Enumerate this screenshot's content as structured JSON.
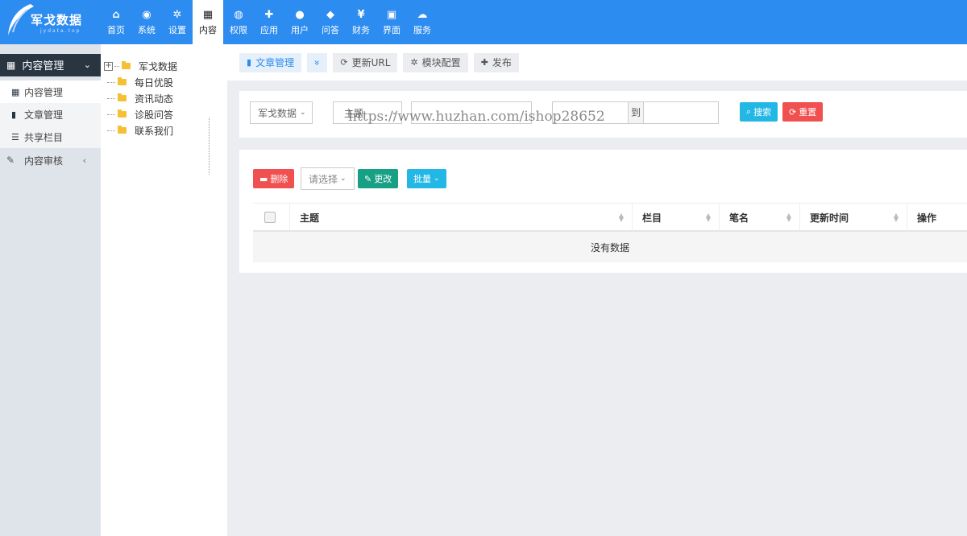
{
  "app": {
    "logo_text": "军戈数据",
    "logo_sub": "jydata.top"
  },
  "topnav": [
    {
      "label": "首页",
      "icon": "home-icon",
      "glyph": "⌂"
    },
    {
      "label": "系统",
      "icon": "globe-icon",
      "glyph": "◉"
    },
    {
      "label": "设置",
      "icon": "gears-icon",
      "glyph": "✲"
    },
    {
      "label": "内容",
      "icon": "grid-icon",
      "glyph": "▦",
      "active": true
    },
    {
      "label": "权限",
      "icon": "user-circle-icon",
      "glyph": "◍"
    },
    {
      "label": "应用",
      "icon": "puzzle-icon",
      "glyph": "✚"
    },
    {
      "label": "用户",
      "icon": "user-icon",
      "glyph": "●"
    },
    {
      "label": "问答",
      "icon": "comment-icon",
      "glyph": "◆"
    },
    {
      "label": "财务",
      "icon": "yen-icon",
      "glyph": "¥"
    },
    {
      "label": "界面",
      "icon": "html5-icon",
      "glyph": "▣"
    },
    {
      "label": "服务",
      "icon": "cloud-icon",
      "glyph": "☁"
    }
  ],
  "sidebar": {
    "section_title": "内容管理",
    "items": [
      {
        "label": "内容管理",
        "icon": "grid-icon",
        "glyph": "▦"
      },
      {
        "label": "文章管理",
        "icon": "file-icon",
        "glyph": "▮"
      },
      {
        "label": "共享栏目",
        "icon": "list-icon",
        "glyph": "☰"
      }
    ],
    "audit_label": "内容审核",
    "audit_glyph": "✎"
  },
  "tree": {
    "root": "军戈数据",
    "children": [
      "每日优股",
      "资讯动态",
      "诊股问答",
      "联系我们"
    ]
  },
  "tabs": {
    "article_manage": "文章管理",
    "dropdown_glyph": "»",
    "refresh_url": "更新URL",
    "module_config": "模块配置",
    "publish": "发布"
  },
  "search": {
    "site_select": "军戈数据",
    "field_select": "主题",
    "keyword_value": "",
    "date_from": "",
    "to_label": "到",
    "date_to": "",
    "search_button": "搜索",
    "reset_button": "重置"
  },
  "watermark": "https://www.huzhan.com/ishop28652",
  "actions": {
    "delete": "删除",
    "select_placeholder": "请选择",
    "change": "更改",
    "batch": "批量"
  },
  "table": {
    "columns": [
      "主题",
      "栏目",
      "笔名",
      "更新时间",
      "操作"
    ],
    "empty_text": "没有数据"
  }
}
